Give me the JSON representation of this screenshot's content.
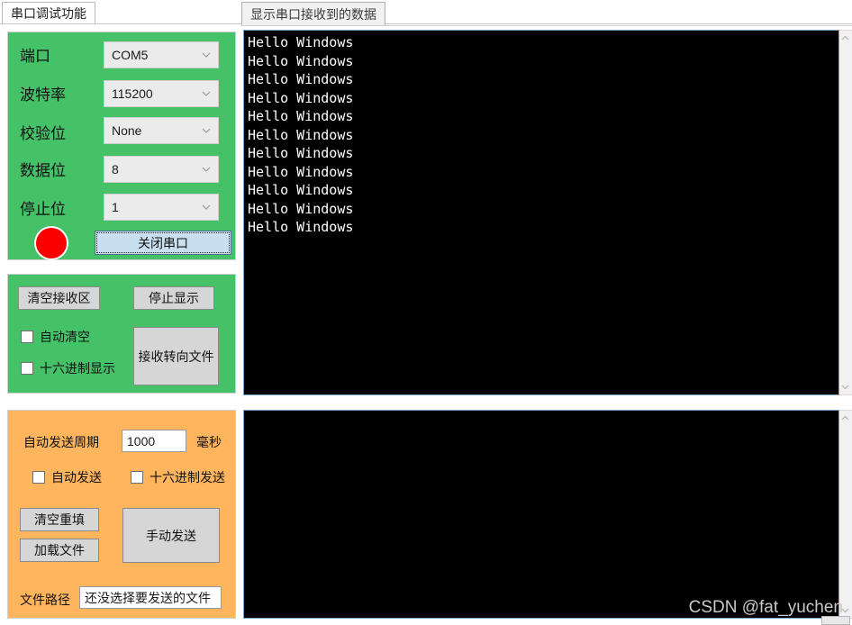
{
  "window": {
    "title": "串口调试功能",
    "watermark": "CSDN @fat_yuchen"
  },
  "tabs": [
    {
      "id": "main",
      "label": "串口调试功能",
      "active": true
    },
    {
      "id": "recv",
      "label": "显示串口接收到的数据",
      "active": false
    }
  ],
  "port_panel": {
    "color": "#45c168",
    "fields": [
      {
        "label": "端口",
        "value": "COM5"
      },
      {
        "label": "波特率",
        "value": "115200"
      },
      {
        "label": "校验位",
        "value": "None"
      },
      {
        "label": "数据位",
        "value": "8"
      },
      {
        "label": "停止位",
        "value": "1"
      }
    ],
    "led": {
      "name": "status-led",
      "color": "#fb0000",
      "state": "on"
    },
    "toggle_button": {
      "label": "关闭串口",
      "focused": true,
      "color": "#c8dff0"
    }
  },
  "receive_panel": {
    "color": "#45c168",
    "clear_button": "清空接收区",
    "stop_button": "停止显示",
    "redirect_button": "接收转向文件",
    "checkboxes": [
      {
        "label": "自动清空",
        "checked": false
      },
      {
        "label": "十六进制显示",
        "checked": false
      }
    ]
  },
  "send_panel": {
    "color": "#ffb55e",
    "period_label": "自动发送周期",
    "period_value": "1000",
    "period_unit": "毫秒",
    "checkboxes": [
      {
        "label": "自动发送",
        "checked": false
      },
      {
        "label": "十六进制发送",
        "checked": false
      }
    ],
    "clear_button": "清空重填",
    "load_button": "加载文件",
    "manual_send_button": "手动发送",
    "filepath_label": "文件路径",
    "filepath_value": "还没选择要发送的文件"
  },
  "receive_console": {
    "name": "receive-textarea",
    "background": "#000000",
    "foreground": "#ffffff",
    "content": "Hello Windows\nHello Windows\nHello Windows\nHello Windows\nHello Windows\nHello Windows\nHello Windows\nHello Windows\nHello Windows\nHello Windows\nHello Windows"
  },
  "send_console": {
    "name": "send-textarea",
    "background": "#000000",
    "foreground": "#ffffff",
    "content": ""
  }
}
